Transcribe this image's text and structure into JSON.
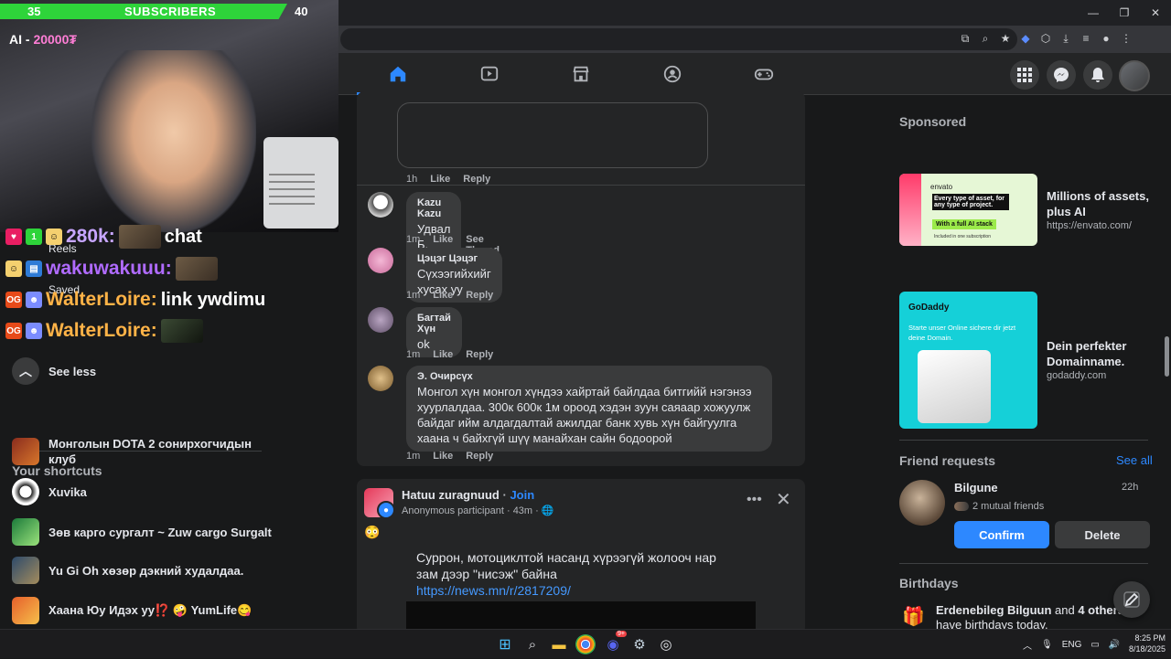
{
  "browser": {
    "new_tab_glyph": "+",
    "window_controls": [
      "—",
      "❐",
      "✕"
    ]
  },
  "stream": {
    "sub_goal_current": "35",
    "sub_goal_label": "SUBSCRIBERS",
    "sub_goal_target": "40",
    "sub_goal_progress": 0.875,
    "ai_label": "AI - ",
    "ai_value": "20000₮",
    "chat": [
      {
        "user": "280k:",
        "user_color": "#c7a6ff",
        "msg": "chat"
      },
      {
        "user": "wakuwakuuu:",
        "user_color": "#b06bff",
        "msg": ""
      },
      {
        "user": "WalterLoire:",
        "user_color": "#ffb347",
        "msg": "link ywdimu"
      },
      {
        "user": "WalterLoire:",
        "user_color": "#ffb347",
        "msg": ""
      }
    ]
  },
  "sidebar": {
    "peek_items": [
      "Reels",
      "Saved"
    ],
    "see_less": "See less",
    "shortcuts_title": "Your shortcuts",
    "shortcuts": [
      "Монголын DOTA 2 сонирхогчидын клуб",
      "Xuvika",
      "Зөв карго сургалт ~ Zuw cargo Surgalt",
      "Yu Gi Oh хөзөр дэкний худалдаа.",
      "Хаана Юу Идэх уу⁉️ 🤪 YumLife😋"
    ]
  },
  "feed": {
    "top_comment_actions": {
      "time": "1h",
      "like": "Like",
      "reply": "Reply"
    },
    "comments": [
      {
        "name": "Kazu Kazu",
        "text": "Удвал Б. Thh",
        "time": "1m",
        "like": "Like",
        "extra": "See Thread",
        "avatar": "#d0d0d0"
      },
      {
        "name": "Цэцэг Цэцэг",
        "text": "Сүхээгийхийг хусах уу",
        "time": "1m",
        "like": "Like",
        "extra": "Reply",
        "avatar": "#e9a2c7"
      },
      {
        "name": "Багтай Хүн",
        "text": "ok",
        "time": "1m",
        "like": "Like",
        "extra": "Reply",
        "avatar": "#8a7b90"
      },
      {
        "name": "Э. Очирсүх",
        "text": "Монгол хүн монгол хүндээ хайртай байлдаа битгийй нэгэнээ хуурлалдаа. 300к 600к 1м ороод хэдэн зуун саяаар хожуулж байдаг ийм алдагдалтай ажилдаг банк хувь хүн байгуулга хаана ч байхгүй шүү манайхан сайн бодоорой",
        "time": "1m",
        "like": "Like",
        "extra": "Reply",
        "avatar": "#b08d5a"
      }
    ],
    "post": {
      "group": "Hatuu zuragnuud",
      "join": "Join",
      "sep": " · ",
      "author": "Anonymous participant",
      "time": "43m",
      "emoji": "😳",
      "body": "Суррон, мотоциклтой насанд хүрээгүй жолооч нар зам дээр \"нисэж\" байна",
      "link": "https://news.mn/r/2817209/"
    }
  },
  "right": {
    "sponsored": "Sponsored",
    "ads": [
      {
        "title": "Millions of assets, plus AI",
        "url": "https://envato.com/",
        "brand": "envato",
        "tagline": "Every type of asset, for any type of project.",
        "cta": "With a full AI stack",
        "fine": "Included in one subscription"
      },
      {
        "title": "Dein perfekter Domainname.",
        "url": "godaddy.com",
        "brand": "GoDaddy",
        "tagline": "Starte unser Online sichere dir jetzt deine Domain."
      }
    ],
    "friend_requests": "Friend requests",
    "see_all": "See all",
    "request": {
      "name": "Bilgune",
      "time": "22h",
      "mutual": "2 mutual friends",
      "confirm": "Confirm",
      "delete": "Delete"
    },
    "birthdays": "Birthdays",
    "birthday_text_a": "Erdenebileg Bilguun",
    "birthday_text_b": " and ",
    "birthday_text_c": "4 others",
    "birthday_text_d": " have birthdays today."
  },
  "taskbar": {
    "lang": "ENG",
    "time": "8:25 PM",
    "date": "8/18/2025",
    "discord_badge": "9+"
  },
  "colors": {
    "accent": "#2d88ff",
    "fb_bg": "#18191a",
    "card": "#242526",
    "sub_bar": "#2ed43a"
  }
}
